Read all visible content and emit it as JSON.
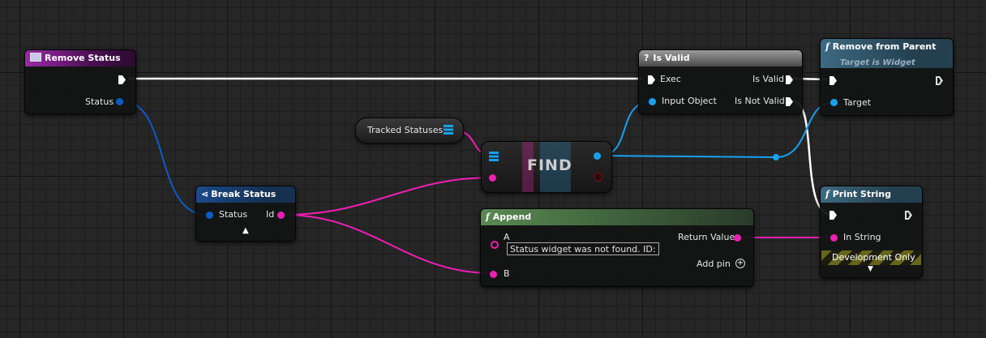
{
  "nodes": {
    "remove_status": {
      "title": "Remove Status",
      "pin_status": "Status"
    },
    "break_status": {
      "title": "Break Status",
      "pin_status": "Status",
      "pin_id": "Id"
    },
    "tracked_statuses": {
      "label": "Tracked Statuses"
    },
    "find": {
      "label": "FIND"
    },
    "is_valid": {
      "title": "Is Valid",
      "icon": "?",
      "pin_exec": "Exec",
      "pin_input_object": "Input Object",
      "pin_is_valid": "Is Valid",
      "pin_is_not_valid": "Is Not Valid"
    },
    "remove_from_parent": {
      "title": "Remove from Parent",
      "subtitle": "Target is Widget",
      "pin_target": "Target"
    },
    "append": {
      "title": "Append",
      "pin_a": "A",
      "a_value": "Status widget was not found. ID:",
      "pin_b": "B",
      "pin_return": "Return Value",
      "add_pin": "Add pin"
    },
    "print_string": {
      "title": "Print String",
      "pin_in_string": "In String",
      "dev_label": "Development Only"
    }
  },
  "colors": {
    "exec": "#ffffff",
    "object": "#18a0f0",
    "struct": "#0a5cc8",
    "string": "#f01eb4",
    "event_header": "#7a1a8a",
    "function_header": "#3a5a6e",
    "pure_header": "#4a6a44"
  }
}
